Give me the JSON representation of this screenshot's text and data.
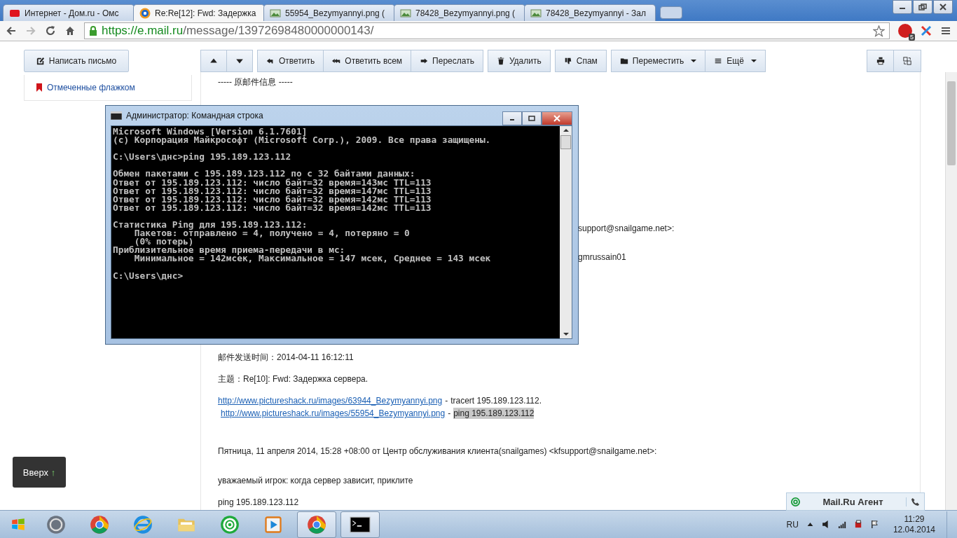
{
  "browser": {
    "tabs": [
      {
        "title": "Интернет - Дом.ru - Омс",
        "kind": "red",
        "selected": false
      },
      {
        "title": "Re:Re[12]: Fwd: Задержка",
        "kind": "mail",
        "selected": true
      },
      {
        "title": "55954_Bezymyannyi.png (",
        "kind": "image",
        "selected": false
      },
      {
        "title": "78428_Bezymyannyi.png (",
        "kind": "image",
        "selected": false
      },
      {
        "title": "78428_Bezymyannyi - Зал",
        "kind": "image",
        "selected": false
      }
    ],
    "url_host": "https://e.mail.ru",
    "url_path": "/message/13972698480000000143/",
    "adblock_badge": "5"
  },
  "toolbar": {
    "compose": "Написать письмо",
    "groups": [
      [
        {
          "kind": "up"
        },
        {
          "kind": "down"
        }
      ],
      [
        {
          "kind": "reply",
          "label": "Ответить"
        },
        {
          "kind": "reply_all",
          "label": "Ответить всем"
        },
        {
          "kind": "forward",
          "label": "Переслать"
        }
      ],
      [
        {
          "kind": "delete",
          "label": "Удалить"
        }
      ],
      [
        {
          "kind": "spam",
          "label": "Спам"
        }
      ],
      [
        {
          "kind": "move",
          "label": "Переместить"
        },
        {
          "kind": "more",
          "label": "Ещё"
        }
      ]
    ],
    "right": [
      {
        "kind": "print"
      },
      {
        "kind": "translate"
      }
    ]
  },
  "sidebar": {
    "flagged": "Отмеченные флажком"
  },
  "mail": {
    "quote_header": "----- 原邮件信息 -----",
    "fragment_1": "support@snailgame.net>:",
    "fragment_2": "gmrussain01",
    "sent_label": "邮件发送时间：",
    "sent": "2014-04-11 16:12:11",
    "subject_label": "主题：",
    "subject": "Re[10]: Fwd: Задержка сервера.",
    "links": [
      {
        "url": "http://www.pictureshack.ru/images/63944_Bezymyannyi.png",
        "sep": "-",
        "note": "tracert 195.189.123.112.",
        "highlighted": false
      },
      {
        "url": "http://www.pictureshack.ru/images/55954_Bezymyannyi.png",
        "sep": "-",
        "note": "ping 195.189.123.112",
        "highlighted": true
      }
    ],
    "reply_header": "Пятница, 11 апреля 2014, 15:28 +08:00 от Центр обслуживания клиента(snailgames) <kfsupport@snailgame.net>:",
    "body": [
      "уважаемый игрок: когда сервер зависит, приклите",
      "ping 195.189.123.112"
    ]
  },
  "up_button": {
    "label": "Вверх",
    "arrow": "↑"
  },
  "agent": {
    "label": "Mail.Ru Агент"
  },
  "console": {
    "title": "Администратор: Командная строка",
    "paragraphs": [
      [
        "Microsoft Windows [Version 6.1.7601]",
        "(c) Корпорация Майкрософт (Microsoft Corp.), 2009. Все права защищены."
      ],
      [
        "C:\\Users\\днс>ping 195.189.123.112"
      ],
      [
        "Обмен пакетами с 195.189.123.112 по с 32 байтами данных:",
        "Ответ от 195.189.123.112: число байт=32 время=143мс TTL=113",
        "Ответ от 195.189.123.112: число байт=32 время=147мс TTL=113",
        "Ответ от 195.189.123.112: число байт=32 время=142мс TTL=113",
        "Ответ от 195.189.123.112: число байт=32 время=142мс TTL=113"
      ],
      [
        "Статистика Ping для 195.189.123.112:",
        "    Пакетов: отправлено = 4, получено = 4, потеряно = 0",
        "    (0% потерь)",
        "Приблизительное время приема-передачи в мс:",
        "    Минимальное = 142мсек, Максимальное = 147 мсек, Среднее = 143 мсек"
      ],
      [
        "C:\\Users\\днс>"
      ]
    ]
  },
  "taskbar": {
    "apps": [
      {
        "kind": "disc",
        "active": false
      },
      {
        "kind": "chrome",
        "active": false
      },
      {
        "kind": "ie",
        "active": false
      },
      {
        "kind": "folder",
        "active": false
      },
      {
        "kind": "agent",
        "active": false
      },
      {
        "kind": "player",
        "active": false
      },
      {
        "kind": "chrome",
        "active": true
      },
      {
        "kind": "console",
        "active": true
      }
    ],
    "language": "RU",
    "time": "11:29",
    "date": "12.04.2014"
  }
}
